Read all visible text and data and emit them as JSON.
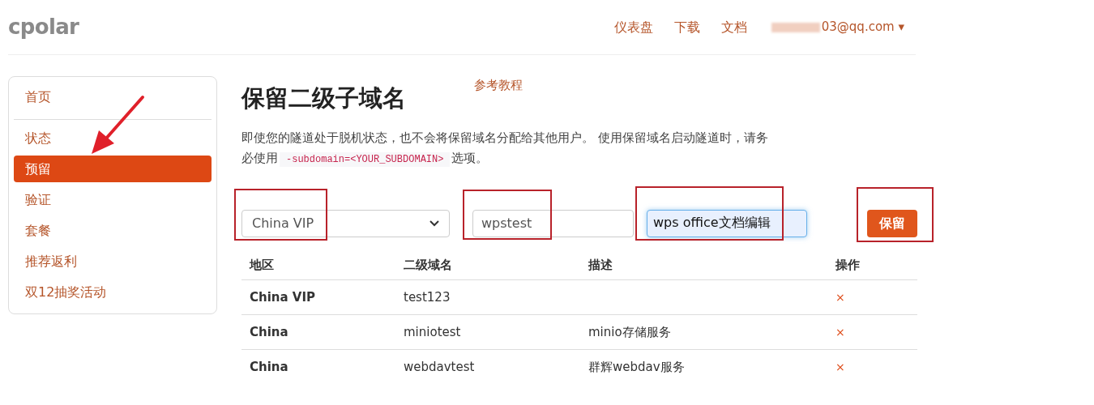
{
  "brand": "cpolar",
  "nav": [
    {
      "label": "仪表盘"
    },
    {
      "label": "下载"
    },
    {
      "label": "文档"
    }
  ],
  "account": {
    "email": "03@qq.com",
    "caret": "▾"
  },
  "sidebar": {
    "items": [
      {
        "label": "首页",
        "selected": false
      },
      {
        "label": "状态",
        "selected": false
      },
      {
        "label": "预留",
        "selected": true
      },
      {
        "label": "验证",
        "selected": false
      },
      {
        "label": "套餐",
        "selected": false
      },
      {
        "label": "推荐返利",
        "selected": false
      },
      {
        "label": "双12抽奖活动",
        "selected": false
      }
    ]
  },
  "page": {
    "title": "保留二级子域名",
    "tutorial_link": "参考教程",
    "description_before": "即使您的隧道处于脱机状态，也不会将保留域名分配给其他用户。 使用保留域名启动隧道时，请务必使用",
    "code": "-subdomain=<YOUR_SUBDOMAIN>",
    "description_after": "选项。"
  },
  "form": {
    "region": "China VIP",
    "subdomain": "wpstest",
    "description": "wps office文档编辑",
    "button": "保留"
  },
  "table": {
    "columns": [
      "地区",
      "二级域名",
      "描述",
      "操作"
    ],
    "rows": [
      {
        "region": "China VIP",
        "subdomain": "test123",
        "description": "",
        "action": "×"
      },
      {
        "region": "China",
        "subdomain": "miniotest",
        "description": "minio存储服务",
        "action": "×"
      },
      {
        "region": "China",
        "subdomain": "webdavtest",
        "description": "群辉webdav服务",
        "action": "×"
      }
    ]
  }
}
